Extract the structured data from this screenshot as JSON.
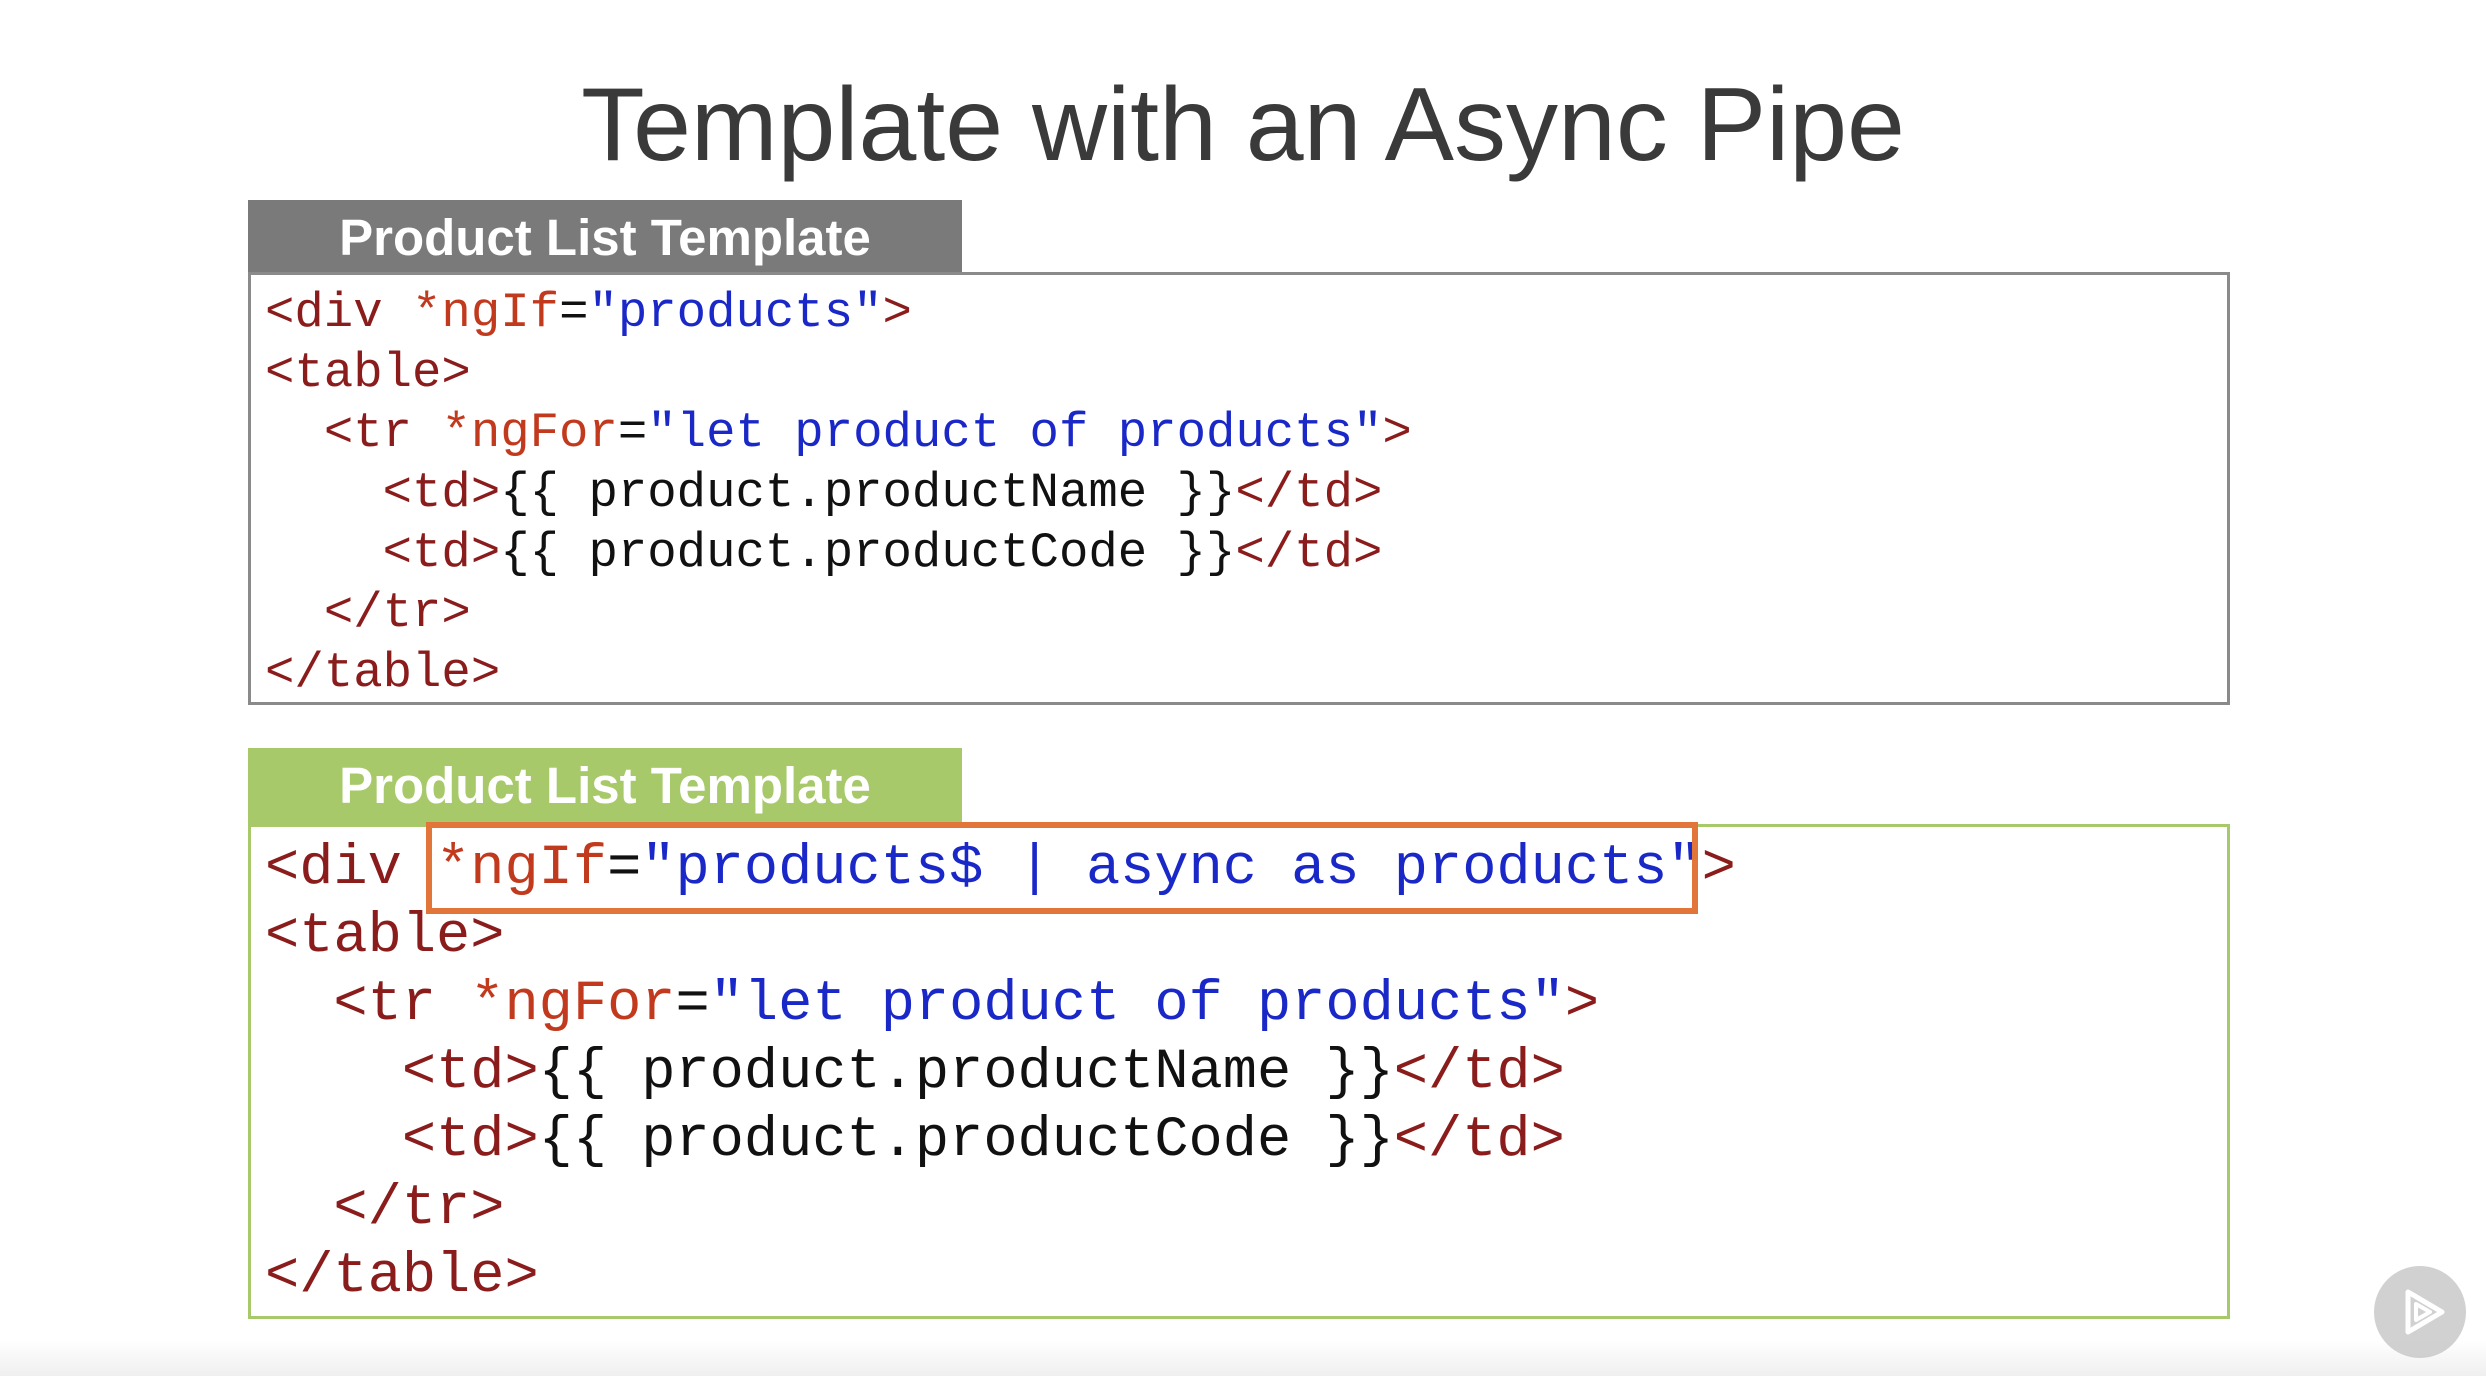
{
  "slide": {
    "title": "Template with an Async Pipe"
  },
  "top_panel": {
    "tab_label": "Product List Template",
    "lines": [
      [
        {
          "c": "t",
          "v": "<div "
        },
        {
          "c": "d",
          "v": "*ngIf"
        },
        {
          "c": "p",
          "v": "="
        },
        {
          "c": "s",
          "v": "\"products\""
        },
        {
          "c": "t",
          "v": ">"
        }
      ],
      [
        {
          "c": "t",
          "v": "<table>"
        }
      ],
      [
        {
          "c": "p",
          "v": "  "
        },
        {
          "c": "t",
          "v": "<tr "
        },
        {
          "c": "d",
          "v": "*ngFor"
        },
        {
          "c": "p",
          "v": "="
        },
        {
          "c": "s",
          "v": "\"let product of products\""
        },
        {
          "c": "t",
          "v": ">"
        }
      ],
      [
        {
          "c": "p",
          "v": "    "
        },
        {
          "c": "t",
          "v": "<td>"
        },
        {
          "c": "p",
          "v": "{{ product.productName }}"
        },
        {
          "c": "t",
          "v": "</td>"
        }
      ],
      [
        {
          "c": "p",
          "v": "    "
        },
        {
          "c": "t",
          "v": "<td>"
        },
        {
          "c": "p",
          "v": "{{ product.productCode }}"
        },
        {
          "c": "t",
          "v": "</td>"
        }
      ],
      [
        {
          "c": "p",
          "v": "  "
        },
        {
          "c": "t",
          "v": "</tr>"
        }
      ],
      [
        {
          "c": "t",
          "v": "</table>"
        }
      ]
    ]
  },
  "bottom_panel": {
    "tab_label": "Product List Template",
    "lines": [
      [
        {
          "c": "t",
          "v": "<div "
        },
        {
          "c": "d",
          "v": "*ngIf"
        },
        {
          "c": "p",
          "v": "="
        },
        {
          "c": "s",
          "v": "\"products$ | async as products\""
        },
        {
          "c": "t",
          "v": ">"
        }
      ],
      [
        {
          "c": "t",
          "v": "<table>"
        }
      ],
      [
        {
          "c": "p",
          "v": "  "
        },
        {
          "c": "t",
          "v": "<tr "
        },
        {
          "c": "d",
          "v": "*ngFor"
        },
        {
          "c": "p",
          "v": "="
        },
        {
          "c": "s",
          "v": "\"let product of products\""
        },
        {
          "c": "t",
          "v": ">"
        }
      ],
      [
        {
          "c": "p",
          "v": "    "
        },
        {
          "c": "t",
          "v": "<td>"
        },
        {
          "c": "p",
          "v": "{{ product.productName }}"
        },
        {
          "c": "t",
          "v": "</td>"
        }
      ],
      [
        {
          "c": "p",
          "v": "    "
        },
        {
          "c": "t",
          "v": "<td>"
        },
        {
          "c": "p",
          "v": "{{ product.productCode }}"
        },
        {
          "c": "t",
          "v": "</td>"
        }
      ],
      [
        {
          "c": "p",
          "v": "  "
        },
        {
          "c": "t",
          "v": "</tr>"
        }
      ],
      [
        {
          "c": "t",
          "v": "</table>"
        }
      ]
    ],
    "highlight_color": "#e2763a"
  },
  "colors": {
    "tab_gray": "#7a7a7a",
    "tab_green": "#a7c96a",
    "tag": "#8b1c1c",
    "directive": "#c23a1e",
    "string": "#1a28c8"
  },
  "player": {
    "icon": "play-icon"
  }
}
